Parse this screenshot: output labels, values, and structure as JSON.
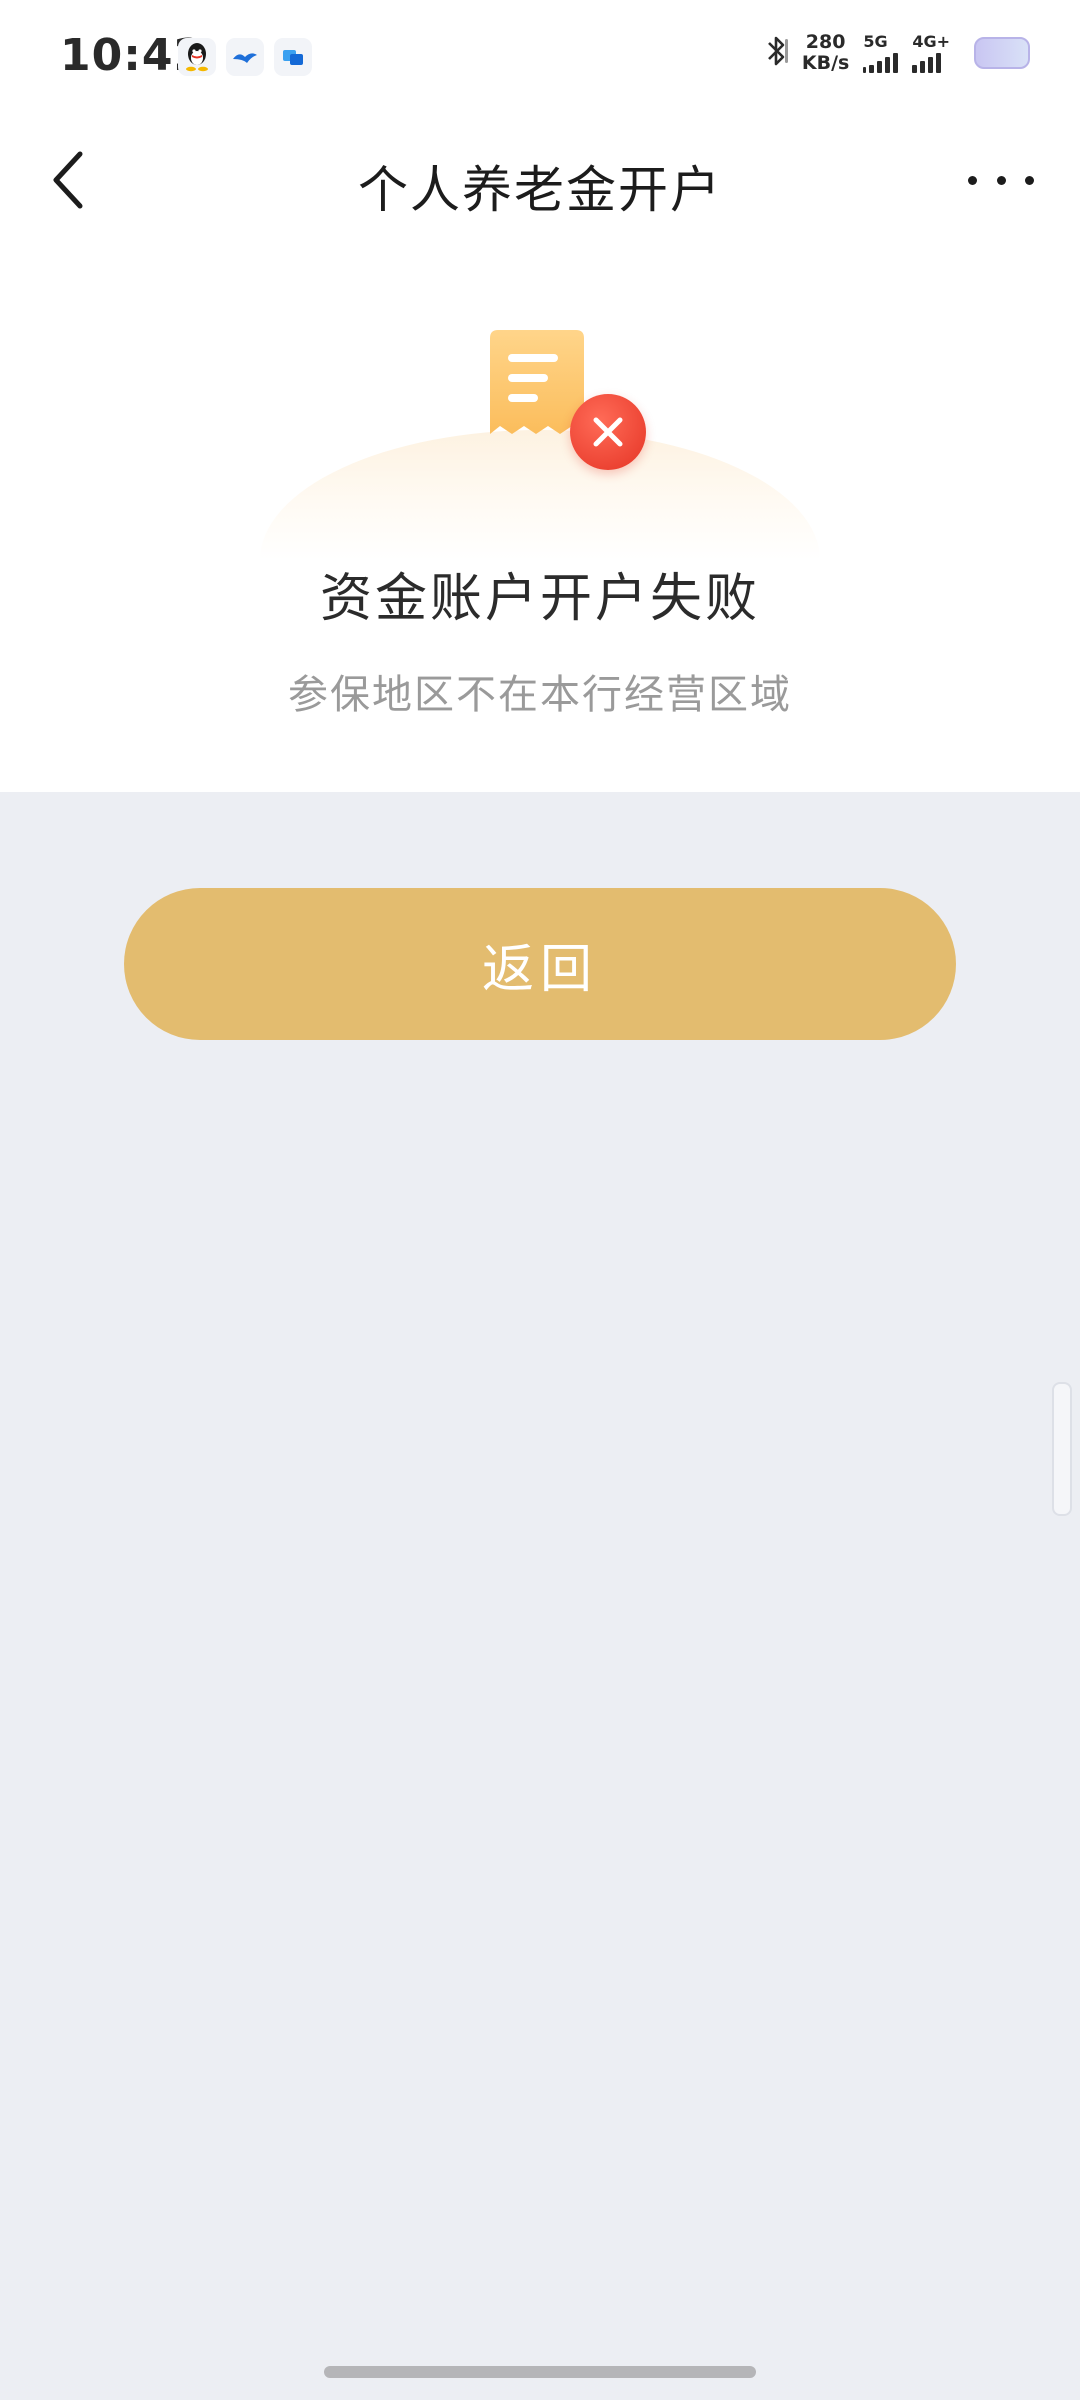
{
  "status_bar": {
    "time": "10:42",
    "notification_icons": [
      "qq-icon",
      "bird-app-icon",
      "chat-app-icon"
    ],
    "bluetooth_icon": "bluetooth-icon",
    "network_speed_value": "280",
    "network_speed_unit": "KB/s",
    "network_primary": "5G",
    "network_secondary": "4G+",
    "battery_icon": "battery-icon"
  },
  "nav": {
    "title": "个人养老金开户",
    "back_icon": "chevron-left-icon",
    "more_icon": "more-horizontal-icon"
  },
  "result": {
    "icon": "receipt-icon",
    "status_icon": "close-circle-icon",
    "title": "资金账户开户失败",
    "message": "参保地区不在本行经营区域"
  },
  "actions": {
    "return_label": "返回"
  },
  "colors": {
    "accent": "#e3bc6f",
    "error": "#e53425",
    "page_background": "#eceef3",
    "card_background": "#ffffff",
    "subtitle_text": "#9a9a9a"
  }
}
